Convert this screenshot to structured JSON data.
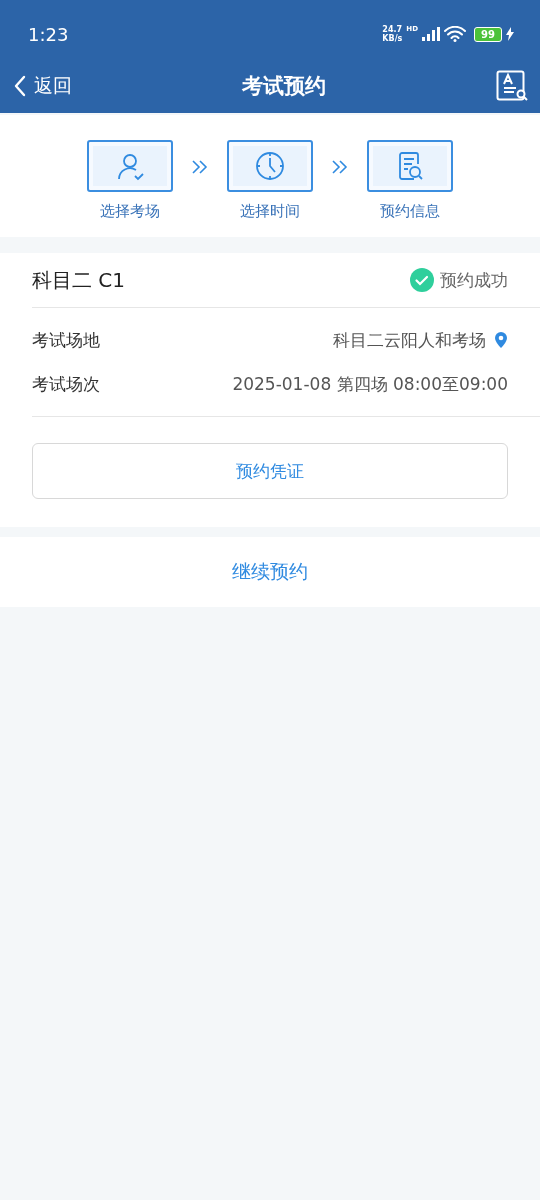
{
  "status_bar": {
    "time": "1:23",
    "speed_value": "24.7",
    "speed_unit": "KB/s",
    "network": "HD",
    "battery": "99"
  },
  "header": {
    "back": "返回",
    "title": "考试预约"
  },
  "steps": [
    {
      "kind": "venue",
      "label": "选择考场"
    },
    {
      "kind": "time",
      "label": "选择时间"
    },
    {
      "kind": "info",
      "label": "预约信息"
    }
  ],
  "booking": {
    "subject": "科目二 C1",
    "status": {
      "kind": "success",
      "text": "预约成功"
    },
    "fields": [
      {
        "kind": "location",
        "label": "考试场地",
        "value": "科目二云阳人和考场"
      },
      {
        "kind": "plain",
        "label": "考试场次",
        "value": "2025-01-08 第四场 08:00至09:00"
      }
    ],
    "voucher_button": "预约凭证"
  },
  "continue_button": "继续预约"
}
